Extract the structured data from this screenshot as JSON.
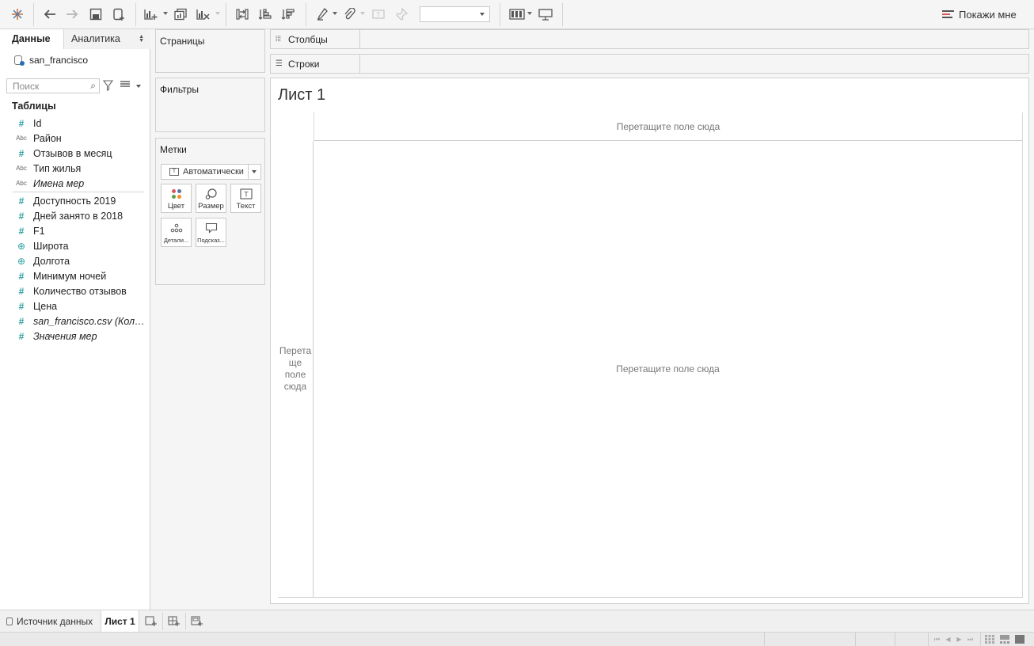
{
  "toolbar": {
    "icons": [
      "tableau-logo-icon",
      "undo-icon",
      "redo-icon",
      "save-icon",
      "new-data-source-icon",
      "new-worksheet-icon",
      "duplicate-icon",
      "clear-icon",
      "swap-icon",
      "sort-ascending-icon",
      "sort-descending-icon",
      "highlight-icon",
      "group-icon",
      "labels-icon",
      "fix-axes-icon",
      "fit-dropdown",
      "show-cards-icon",
      "presentation-icon"
    ],
    "fit_value": "",
    "show_me": "Покажи мне"
  },
  "data_pane": {
    "tab_data": "Данные",
    "tab_analytics": "Аналитика",
    "datasource": "san_francisco",
    "search_placeholder": "Поиск",
    "tables_heading": "Таблицы",
    "dimensions": [
      {
        "name": "Id",
        "type": "number"
      },
      {
        "name": "Район",
        "type": "string"
      },
      {
        "name": "Отзывов в месяц",
        "type": "number"
      },
      {
        "name": "Тип жилья",
        "type": "string"
      },
      {
        "name": "Имена мер",
        "type": "string",
        "italic": true
      }
    ],
    "measures": [
      {
        "name": "Доступность 2019",
        "type": "number"
      },
      {
        "name": "Дней занято в 2018",
        "type": "number"
      },
      {
        "name": "F1",
        "type": "number"
      },
      {
        "name": "Широта",
        "type": "geo"
      },
      {
        "name": "Долгота",
        "type": "geo"
      },
      {
        "name": "Минимум ночей",
        "type": "number"
      },
      {
        "name": "Количество отзывов",
        "type": "number"
      },
      {
        "name": "Цена",
        "type": "number"
      },
      {
        "name": "san_francisco.csv (Количество)",
        "type": "number",
        "italic": true
      },
      {
        "name": "Значения мер",
        "type": "number",
        "italic": true
      }
    ]
  },
  "cards": {
    "pages": "Страницы",
    "filters": "Фильтры",
    "marks": "Метки",
    "mark_type": "Автоматически",
    "mark_buttons": {
      "color": "Цвет",
      "size": "Размер",
      "text": "Текст",
      "detail": "Детали...",
      "tooltip": "Подсказ..."
    }
  },
  "shelves": {
    "columns": "Столбцы",
    "rows": "Строки"
  },
  "sheet": {
    "title": "Лист 1",
    "drop_columns": "Перетащите поле сюда",
    "drop_rows": "Перета ще поле сюда",
    "drop_main": "Перетащите поле сюда"
  },
  "tabs": {
    "datasource": "Источник данных",
    "sheet": "Лист 1"
  },
  "colors": {
    "accent": "#2a9f9f",
    "color_dots": [
      "#e15759",
      "#4e79a7",
      "#59a14f",
      "#f28e2b"
    ]
  }
}
